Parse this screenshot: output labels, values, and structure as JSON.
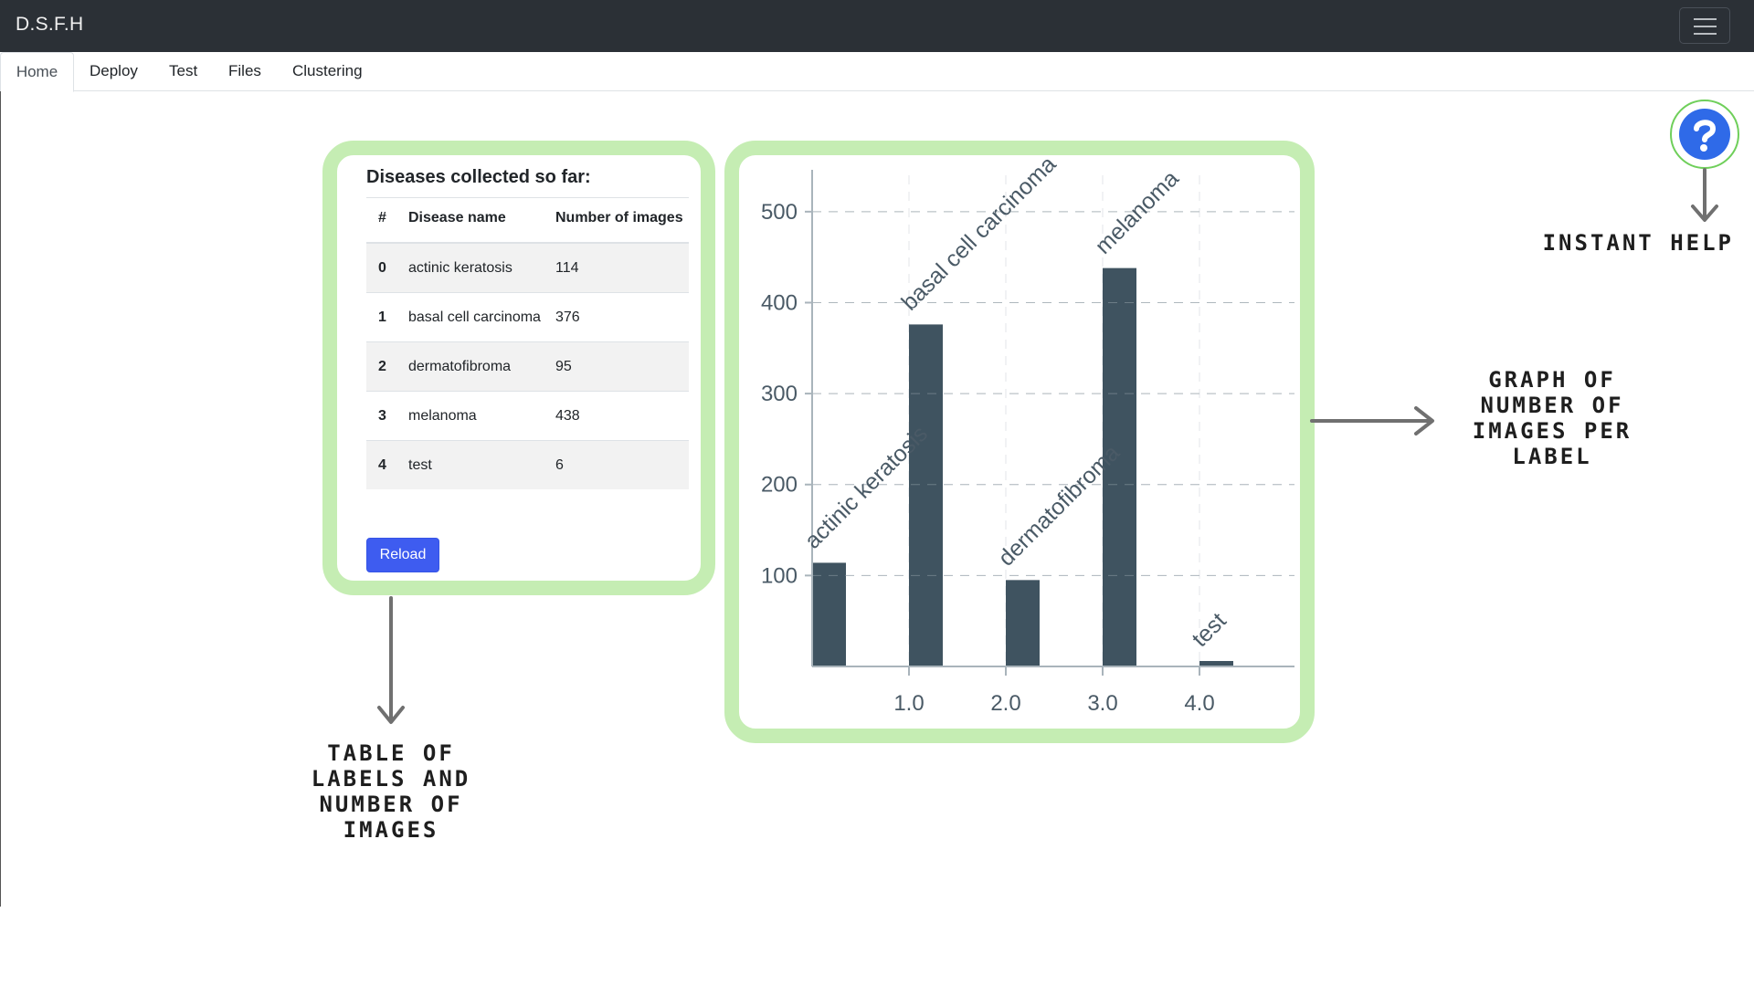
{
  "app": {
    "brand": "D.S.F.H"
  },
  "tabs": [
    {
      "label": "Home",
      "active": true
    },
    {
      "label": "Deploy",
      "active": false
    },
    {
      "label": "Test",
      "active": false
    },
    {
      "label": "Files",
      "active": false
    },
    {
      "label": "Clustering",
      "active": false
    }
  ],
  "card": {
    "title": "Diseases collected so far:",
    "columns": [
      "#",
      "Disease name",
      "Number of images"
    ],
    "rows": [
      {
        "index": "0",
        "name": "actinic keratosis",
        "count": "114"
      },
      {
        "index": "1",
        "name": "basal cell carcinoma",
        "count": "376"
      },
      {
        "index": "2",
        "name": "dermatofibroma",
        "count": "95"
      },
      {
        "index": "3",
        "name": "melanoma",
        "count": "438"
      },
      {
        "index": "4",
        "name": "test",
        "count": "6"
      }
    ],
    "reload_label": "Reload"
  },
  "chart_data": {
    "type": "bar",
    "x": [
      0,
      1,
      2,
      3,
      4
    ],
    "categories": [
      "actinic keratosis",
      "basal cell carcinoma",
      "dermatofibroma",
      "melanoma",
      "test"
    ],
    "values": [
      114,
      376,
      95,
      438,
      6
    ],
    "x_ticks": [
      "1.0",
      "2.0",
      "3.0",
      "4.0"
    ],
    "y_ticks": [
      "100",
      "200",
      "300",
      "400",
      "500"
    ],
    "ylim": [
      0,
      540
    ],
    "grid": true,
    "bar_color": "#3f5360"
  },
  "annotations": {
    "instant_help": "INSTANT HELP",
    "graph": "GRAPH OF NUMBER OF IMAGES PER LABEL",
    "table": "TABLE OF LABELS AND NUMBER OF IMAGES"
  },
  "colors": {
    "navbar": "#2b3036",
    "frame": "#c5edb3",
    "reload": "#3e5cf0",
    "help": "#2f6ae8"
  },
  "icons": {
    "help": "help-icon",
    "menu": "hamburger-icon"
  }
}
